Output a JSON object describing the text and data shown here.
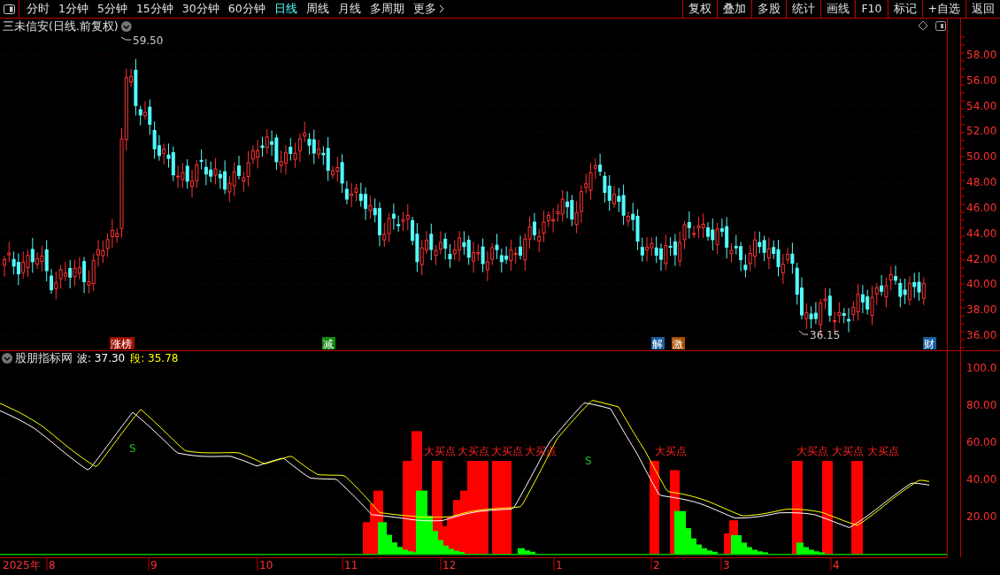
{
  "toolbar": {
    "periods": [
      {
        "label": "分时",
        "selected": false
      },
      {
        "label": "1分钟",
        "selected": false
      },
      {
        "label": "5分钟",
        "selected": false
      },
      {
        "label": "15分钟",
        "selected": false
      },
      {
        "label": "30分钟",
        "selected": false
      },
      {
        "label": "60分钟",
        "selected": false
      },
      {
        "label": "日线",
        "selected": true
      },
      {
        "label": "周线",
        "selected": false
      },
      {
        "label": "月线",
        "selected": false
      },
      {
        "label": "多周期",
        "selected": false
      }
    ],
    "more": "更多",
    "buttons": [
      "复权",
      "叠加",
      "多股",
      "统计",
      "画线",
      "F10",
      "标记",
      "+自选",
      "返回"
    ]
  },
  "main_chart": {
    "title": "三未信安(日线.前复权)",
    "high_label": "59.50",
    "low_label": "36.15",
    "y_axis": [
      "58.00",
      "56.00",
      "54.00",
      "52.00",
      "50.00",
      "48.00",
      "46.00",
      "44.00",
      "42.00",
      "40.00",
      "38.00",
      "36.00"
    ],
    "markers": [
      {
        "label": "涨榜",
        "color": "#a01000"
      },
      {
        "label": "减",
        "color": "#108a10"
      },
      {
        "label": "解",
        "color": "#1a5fa0"
      },
      {
        "label": "激",
        "color": "#a85000"
      },
      {
        "label": "财",
        "color": "#1a5fa0"
      }
    ]
  },
  "indicator": {
    "name": "股朋指标网",
    "readings": [
      {
        "label": "波: 37.30",
        "color": "#ffffff"
      },
      {
        "label": "段: 35.78",
        "color": "#ffff00"
      }
    ],
    "signals": [
      {
        "text": "S",
        "kind": "sell"
      },
      {
        "text": "大买点",
        "kind": "buy"
      },
      {
        "text": "大买点",
        "kind": "buy"
      },
      {
        "text": "大买点",
        "kind": "buy"
      },
      {
        "text": "大买点",
        "kind": "buy"
      },
      {
        "text": "S",
        "kind": "sell"
      },
      {
        "text": "大买点",
        "kind": "buy"
      },
      {
        "text": "大买点",
        "kind": "buy"
      },
      {
        "text": "大买点",
        "kind": "buy"
      },
      {
        "text": "大买点",
        "kind": "buy"
      }
    ],
    "y_axis": [
      "100.0",
      "80.00",
      "60.00",
      "40.00",
      "20.00"
    ]
  },
  "x_axis": [
    "2025年",
    "8",
    "9",
    "10",
    "11",
    "12",
    "1",
    "2",
    "3",
    "4"
  ]
}
